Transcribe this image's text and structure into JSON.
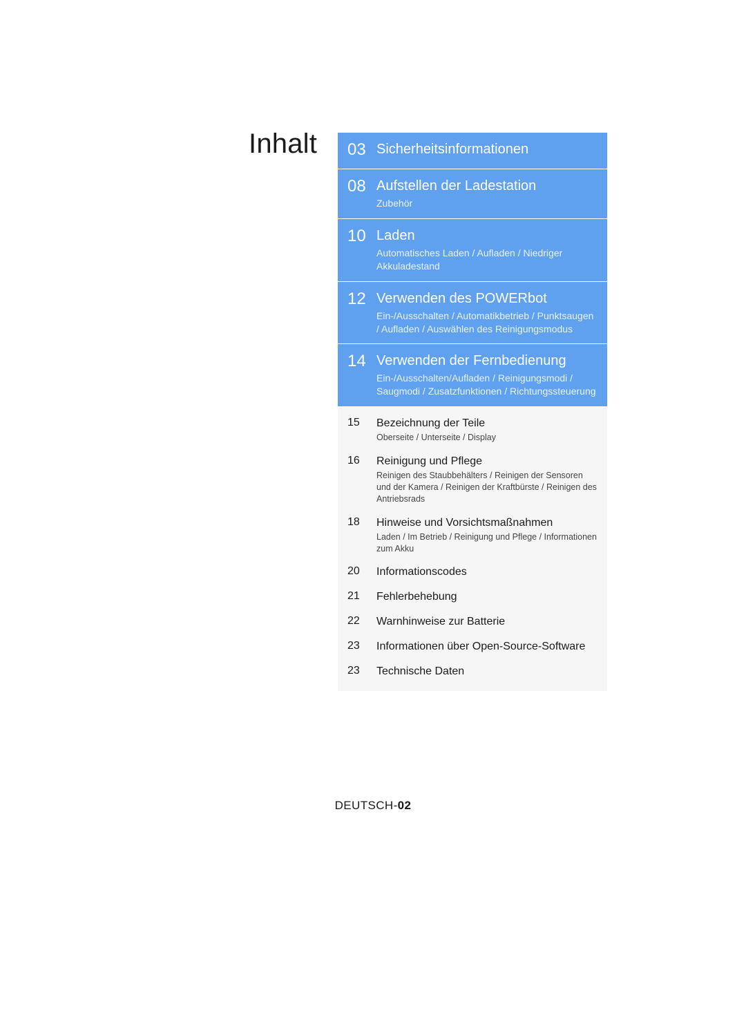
{
  "title": "Inhalt",
  "toc": {
    "major": [
      {
        "page": "03",
        "title": "Sicherheitsinformationen",
        "sub": ""
      },
      {
        "page": "08",
        "title": "Aufstellen der Ladestation",
        "sub": "Zubehör"
      },
      {
        "page": "10",
        "title": "Laden",
        "sub": "Automatisches Laden / Aufladen / Niedriger Akkuladestand"
      },
      {
        "page": "12",
        "title": "Verwenden des POWERbot",
        "sub": "Ein-/Ausschalten / Automatikbetrieb / Punktsaugen / Aufladen / Auswählen des Reinigungsmodus"
      },
      {
        "page": "14",
        "title": "Verwenden der Fernbedienung",
        "sub": "Ein-/Ausschalten/Aufladen / Reinigungsmodi / Saugmodi / Zusatzfunktionen / Richtungssteuerung"
      }
    ],
    "minor": [
      {
        "page": "15",
        "title": "Bezeichnung der Teile",
        "sub": "Oberseite / Unterseite / Display"
      },
      {
        "page": "16",
        "title": "Reinigung und Pflege",
        "sub": "Reinigen des Staubbehälters / Reinigen der Sensoren und der Kamera / Reinigen der Kraftbürste / Reinigen des Antriebsrads"
      },
      {
        "page": "18",
        "title": "Hinweise und Vorsichtsmaßnahmen",
        "sub": "Laden / Im Betrieb / Reinigung und Pflege / Informationen zum Akku"
      },
      {
        "page": "20",
        "title": "Informationscodes",
        "sub": ""
      },
      {
        "page": "21",
        "title": "Fehlerbehebung",
        "sub": ""
      },
      {
        "page": "22",
        "title": "Warnhinweise zur Batterie",
        "sub": ""
      },
      {
        "page": "23",
        "title": "Informationen über Open-Source-Software",
        "sub": ""
      },
      {
        "page": "23",
        "title": "Technische Daten",
        "sub": ""
      }
    ]
  },
  "footer": {
    "lang": "DEUTSCH-",
    "page": "02"
  }
}
